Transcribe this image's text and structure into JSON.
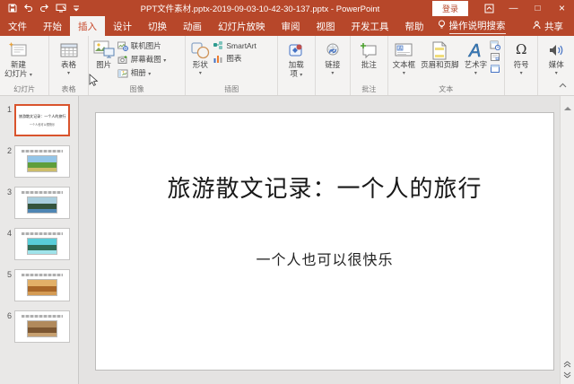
{
  "window": {
    "title": "PPT文件素材.pptx-2019-09-03-10-42-30-137.pptx  -  PowerPoint",
    "sign_in_label": "登录",
    "minimize": "—",
    "maximize": "□",
    "close": "×",
    "accent_color": "#b7472a"
  },
  "tabs": [
    {
      "label": "文件"
    },
    {
      "label": "开始"
    },
    {
      "label": "插入",
      "active": true
    },
    {
      "label": "设计"
    },
    {
      "label": "切换"
    },
    {
      "label": "动画"
    },
    {
      "label": "幻灯片放映"
    },
    {
      "label": "审阅"
    },
    {
      "label": "视图"
    },
    {
      "label": "开发工具"
    },
    {
      "label": "帮助"
    }
  ],
  "tell_me": {
    "label": "操作说明搜索"
  },
  "share": {
    "label": "共享"
  },
  "ribbon": {
    "new_slide": {
      "line1": "新建",
      "line2": "幻灯片"
    },
    "table": {
      "label": "表格"
    },
    "pictures": {
      "label": "图片"
    },
    "online_pictures": {
      "label": "联机图片"
    },
    "screenshot": {
      "label": "屏幕截图"
    },
    "photo_album": {
      "label": "相册"
    },
    "shapes": {
      "label": "形状"
    },
    "smartart": {
      "label": "SmartArt"
    },
    "chart": {
      "label": "图表"
    },
    "addins": {
      "line1": "加载",
      "line2": "项"
    },
    "links": {
      "label": "链接"
    },
    "comment": {
      "label": "批注"
    },
    "text_box": {
      "label": "文本框"
    },
    "header_footer": {
      "label": "页眉和页脚"
    },
    "wordart": {
      "label": "艺术字"
    },
    "symbol": {
      "label": "符号",
      "glyph": "Ω"
    },
    "media": {
      "label": "媒体"
    },
    "group_labels": {
      "slides": "幻灯片",
      "tables": "表格",
      "images": "图像",
      "illustrations": "插图",
      "comments": "批注",
      "text": "文本"
    }
  },
  "slides_panel": {
    "thumbnails": [
      {
        "num": "1",
        "selected": true,
        "kind": "title"
      },
      {
        "num": "2",
        "image_colors": [
          "#93c5e8",
          "#5f9e3c",
          "#cdbd6a"
        ]
      },
      {
        "num": "3",
        "image_colors": [
          "#a9cede",
          "#35543d",
          "#4f86b4"
        ]
      },
      {
        "num": "4",
        "image_colors": [
          "#59cdd9",
          "#2f6a55",
          "#9fe3ea"
        ]
      },
      {
        "num": "5",
        "image_colors": [
          "#e2b068",
          "#a96728",
          "#d49b54"
        ]
      },
      {
        "num": "6",
        "image_colors": [
          "#b18a5c",
          "#7c5631",
          "#c7a171"
        ]
      }
    ]
  },
  "slide": {
    "title": "旅游散文记录：一个人的旅行",
    "subtitle": "一个人也可以很快乐"
  }
}
